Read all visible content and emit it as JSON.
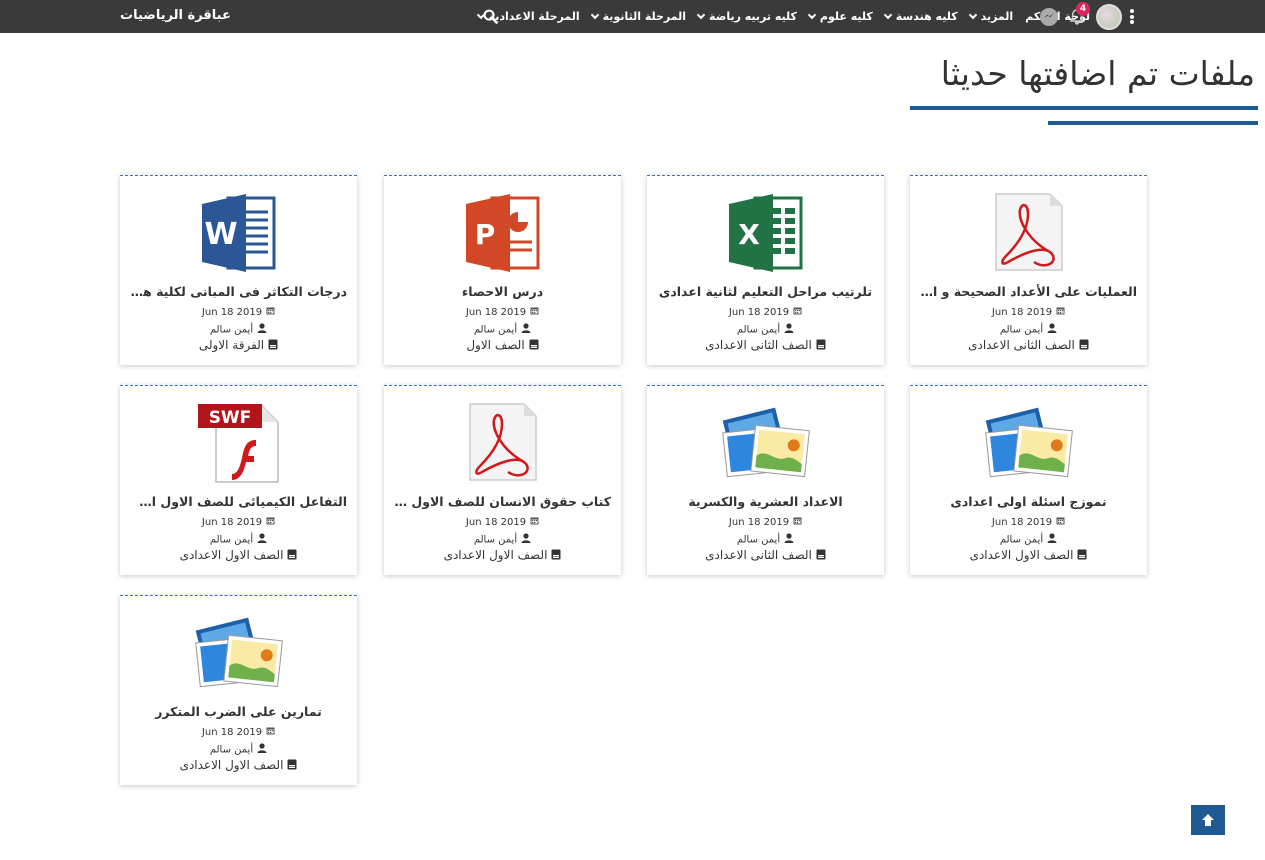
{
  "topbar": {
    "brand": "عباقرة الرياضيات",
    "nav": [
      {
        "label": "المرحلة الاعدادية",
        "dropdown": true
      },
      {
        "label": "المرحلة الثانوية",
        "dropdown": true
      },
      {
        "label": "كليه تربيه رياضة",
        "dropdown": true
      },
      {
        "label": "كليه علوم",
        "dropdown": true
      },
      {
        "label": "كليه هندسة",
        "dropdown": true
      },
      {
        "label": "المزيد",
        "dropdown": true
      },
      {
        "label": "لوحة التحكم",
        "dropdown": false
      }
    ],
    "notification_count": "4",
    "icons": [
      "search-icon",
      "messenger-icon",
      "bell-icon",
      "avatar",
      "kebab-menu-icon"
    ]
  },
  "page": {
    "title": "ملفات تم اضافتها حديثا",
    "accent_color": "#1f5b92"
  },
  "files": [
    {
      "type": "pdf",
      "title": "العمليات على الأعداد الصحيحة و الأعد...",
      "date": "Jun 18 2019",
      "author": "أيمن سالم",
      "grade": "الصف الثانى الاعدادى"
    },
    {
      "type": "xlsx",
      "title": "تلرتيب مراحل التعليم لثانية اعدادى",
      "date": "Jun 18 2019",
      "author": "أيمن سالم",
      "grade": "الصف الثانى الاعدادى"
    },
    {
      "type": "pptx",
      "title": "درس الاحصاء",
      "date": "Jun 18 2019",
      "author": "أيمن سالم",
      "grade": "الصف الاول"
    },
    {
      "type": "docx",
      "title": "درجات التكاثر فى المبانى لكلية هندسة",
      "date": "Jun 18 2019",
      "author": "أيمن سالم",
      "grade": "الفرقة الاولى"
    },
    {
      "type": "image",
      "title": "نموزج اسئلة اولى اعدادى",
      "date": "Jun 18 2019",
      "author": "أيمن سالم",
      "grade": "الصف الاول الاعدادى"
    },
    {
      "type": "image",
      "title": "الاعداد العشرية والكسرية",
      "date": "Jun 18 2019",
      "author": "أيمن سالم",
      "grade": "الصف الثانى الاعدادى"
    },
    {
      "type": "pdf",
      "title": "كتاب حقوق الانسان للصف الاول الاعد...",
      "date": "Jun 18 2019",
      "author": "أيمن سالم",
      "grade": "الصف الاول الاعدادى"
    },
    {
      "type": "swf",
      "title": "التفاعل الكيميائى للصف الاول الاعدادى",
      "date": "Jun 18 2019",
      "author": "أيمن سالم",
      "grade": "الصف الاول الاعدادى"
    },
    {
      "type": "image",
      "title": "تمارين على الضرب المتكرر",
      "date": "Jun 18 2019",
      "author": "أيمن سالم",
      "grade": "الصف الاول الاعدادى"
    }
  ],
  "swf_label": "SWF"
}
